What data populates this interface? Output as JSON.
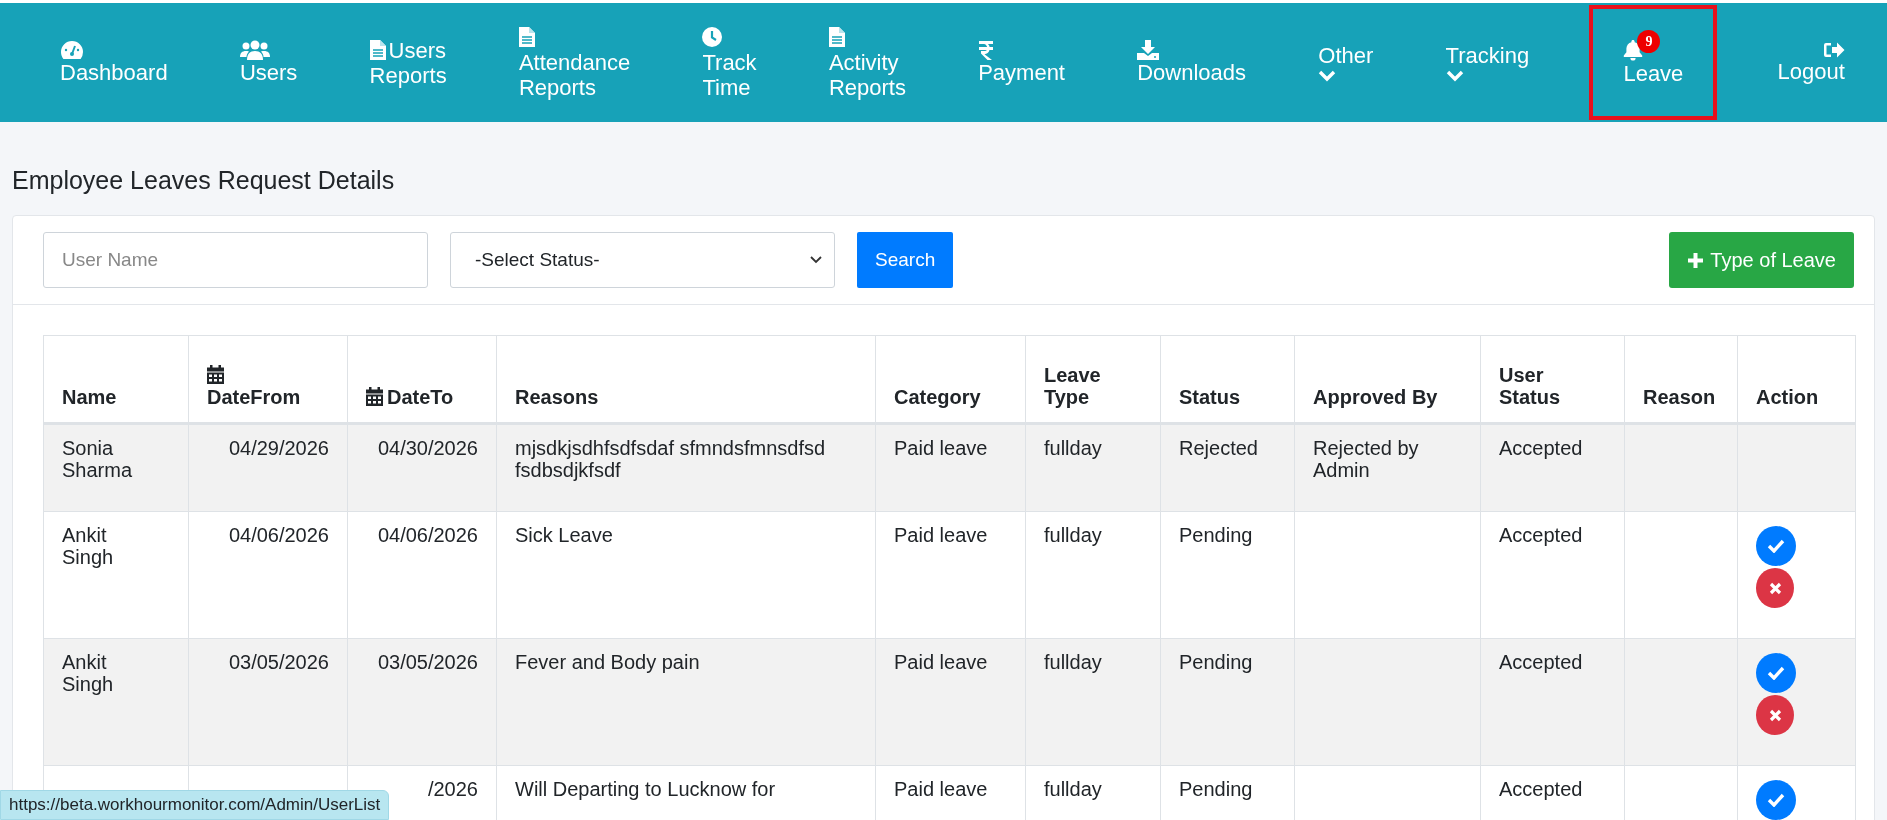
{
  "nav": [
    {
      "label": "Dashboard",
      "kind": "icon-top",
      "highlighted": false
    },
    {
      "label": "Users",
      "kind": "icon-top",
      "highlighted": false
    },
    {
      "label": "Users Reports",
      "kind": "icon-inline",
      "highlighted": false
    },
    {
      "label": "Attendance Reports",
      "kind": "icon-inline",
      "highlighted": false
    },
    {
      "label": "Track Time",
      "kind": "icon-inline",
      "highlighted": false
    },
    {
      "label": "Activity Reports",
      "kind": "icon-inline",
      "highlighted": false
    },
    {
      "label": "Payment",
      "kind": "icon-top",
      "highlighted": false
    },
    {
      "label": "Downloads",
      "kind": "icon-top",
      "highlighted": false
    },
    {
      "label": "Other",
      "kind": "chevron",
      "highlighted": false
    },
    {
      "label": "Tracking",
      "kind": "chevron",
      "highlighted": false
    },
    {
      "label": "Leave",
      "kind": "icon-top",
      "badge": "9",
      "highlighted": true
    },
    {
      "label": "Logout",
      "kind": "icon-top",
      "highlighted": false
    }
  ],
  "page_title": "Employee Leaves Request Details",
  "filters": {
    "user_name": {
      "placeholder": "User Name"
    },
    "status_select": {
      "value": "-Select Status-"
    },
    "search_button": "Search",
    "add_button": "Type of Leave"
  },
  "table": {
    "columns": [
      {
        "label": "Name"
      },
      {
        "label": "DateFrom"
      },
      {
        "label": "DateTo"
      },
      {
        "label": "Reasons"
      },
      {
        "label": "Category"
      },
      {
        "label": "Leave Type"
      },
      {
        "label": "Status"
      },
      {
        "label": "Approved By"
      },
      {
        "label": "User Status"
      },
      {
        "label": "Reason"
      },
      {
        "label": "Action"
      }
    ],
    "rows": [
      {
        "name": "Sonia Sharma",
        "date_from": "04/29/2026",
        "date_to": "04/30/2026",
        "reasons": "mjsdkjsdhfsdfsdaf sfmndsfmnsdfsd fsdbsdjkfsdf",
        "category": "Paid leave",
        "leave_type": "fullday",
        "status": "Rejected",
        "approved_by": "Rejected by Admin",
        "user_status": "Accepted",
        "actions": false
      },
      {
        "name": "Ankit Singh",
        "date_from": "04/06/2026",
        "date_to": "04/06/2026",
        "reasons": "Sick Leave",
        "category": "Paid leave",
        "leave_type": "fullday",
        "status": "Pending",
        "user_status": "Accepted",
        "actions": true
      },
      {
        "name": "Ankit Singh",
        "date_from": "03/05/2026",
        "date_to": "03/05/2026",
        "reasons": "Fever and Body pain",
        "category": "Paid leave",
        "leave_type": "fullday",
        "status": "Pending",
        "user_status": "Accepted",
        "actions": true
      },
      {
        "date_to": "/2026",
        "reasons": "Will Departing to Lucknow for",
        "category": "Paid leave",
        "leave_type": "fullday",
        "status": "Pending",
        "user_status": "Accepted",
        "actions": true
      }
    ]
  },
  "status_url": "https://beta.workhourmonitor.com/Admin/UserList"
}
